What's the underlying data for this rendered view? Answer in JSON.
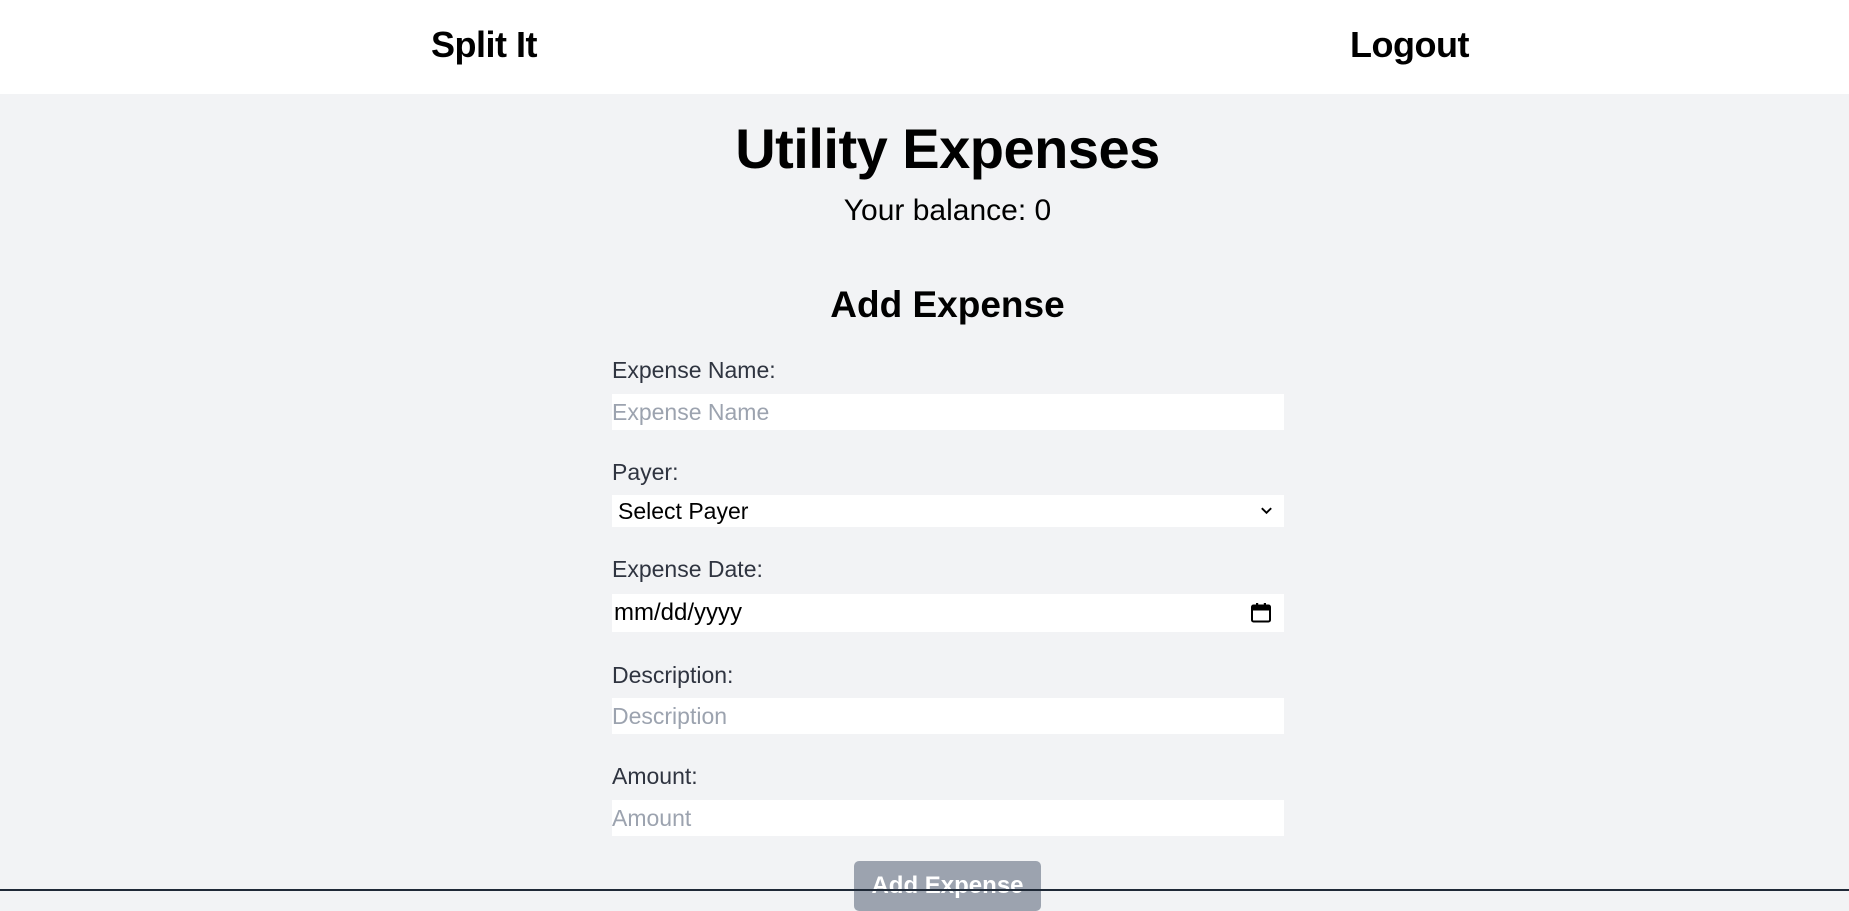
{
  "nav": {
    "brand": "Split It",
    "logout": "Logout"
  },
  "page": {
    "title": "Utility Expenses",
    "balance": "Your balance: 0"
  },
  "form": {
    "title": "Add Expense",
    "expense_name": {
      "label": "Expense Name:",
      "placeholder": "Expense Name",
      "value": ""
    },
    "payer": {
      "label": "Payer:",
      "selected": "Select Payer",
      "icon": "chevron-down-icon"
    },
    "expense_date": {
      "label": "Expense Date:",
      "value": "mm/dd/yyyy",
      "icon": "calendar-icon"
    },
    "description": {
      "label": "Description:",
      "placeholder": "Description",
      "value": ""
    },
    "amount": {
      "label": "Amount:",
      "placeholder": "Amount",
      "value": ""
    },
    "submit_label": "Add Expense"
  },
  "colors": {
    "background": "#f2f3f5",
    "header_background": "#ffffff",
    "label_text": "#2f3440",
    "placeholder_text": "#9ca3af",
    "button_background": "#9ca3af"
  }
}
